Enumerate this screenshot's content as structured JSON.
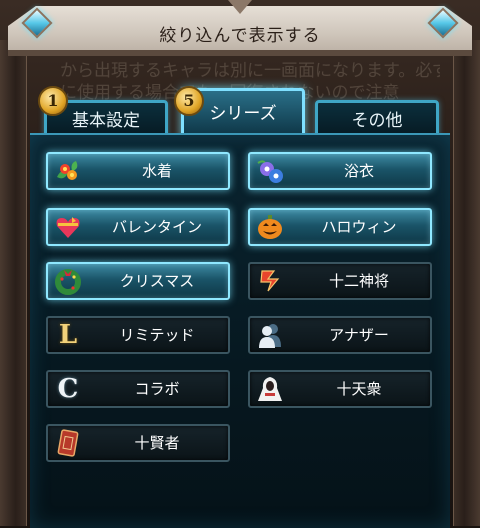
{
  "window": {
    "title": "絞り込んで表示する",
    "background_text": [
      "から出現するキャラは別に一画面になります。必ず先",
      "に使用する場合でも、回復されないので注意"
    ]
  },
  "tabs": [
    {
      "label": "基本設定",
      "badge": "1",
      "active": false
    },
    {
      "label": "シリーズ",
      "badge": "5",
      "active": true
    },
    {
      "label": "その他",
      "badge": "",
      "active": false
    }
  ],
  "series_buttons": [
    {
      "label": "水着",
      "icon": "flower-icon",
      "selected": true
    },
    {
      "label": "浴衣",
      "icon": "morning-glory-icon",
      "selected": true
    },
    {
      "label": "バレンタイン",
      "icon": "heart-gift-icon",
      "selected": true
    },
    {
      "label": "ハロウィン",
      "icon": "pumpkin-icon",
      "selected": true
    },
    {
      "label": "クリスマス",
      "icon": "wreath-icon",
      "selected": true
    },
    {
      "label": "十二神将",
      "icon": "zodiac-emblem-icon",
      "selected": false
    },
    {
      "label": "リミテッド",
      "icon": "letter-l-icon",
      "icon_text": "L",
      "selected": false
    },
    {
      "label": "アナザー",
      "icon": "two-persons-icon",
      "selected": false
    },
    {
      "label": "コラボ",
      "icon": "letter-c-icon",
      "icon_text": "C",
      "selected": false
    },
    {
      "label": "十天衆",
      "icon": "hooded-figure-icon",
      "selected": false
    },
    {
      "label": "十賢者",
      "icon": "card-icon",
      "selected": false
    }
  ],
  "colors": {
    "accent": "#7fe0ff",
    "badge": "#e0a526"
  }
}
